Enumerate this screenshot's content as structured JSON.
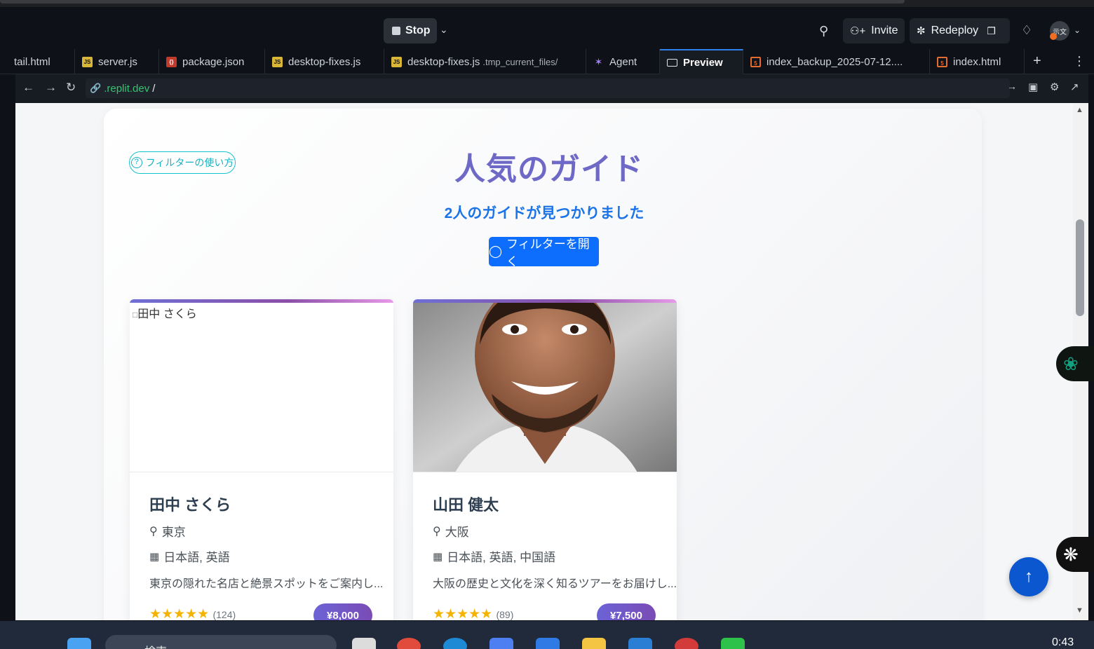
{
  "header": {
    "stop_label": "Stop",
    "invite_label": "Invite",
    "redeploy_label": "Redeploy",
    "avatar_text": "示文"
  },
  "tabs": [
    {
      "label": "tail.html",
      "icon": "html-file-icon"
    },
    {
      "label": "server.js",
      "icon": "js-file-icon"
    },
    {
      "label": "package.json",
      "icon": "json-file-icon"
    },
    {
      "label": "desktop-fixes.js",
      "icon": "js-file-icon"
    },
    {
      "label": "desktop-fixes.js",
      "sub": ".tmp_current_files/",
      "icon": "js-file-icon"
    },
    {
      "label": "Agent",
      "icon": "agent-icon"
    },
    {
      "label": "Preview",
      "icon": "preview-icon",
      "active": true
    },
    {
      "label": "index_backup_2025-07-12....",
      "icon": "html-file-icon"
    },
    {
      "label": "index.html",
      "icon": "html-file-icon"
    }
  ],
  "urlbar": {
    "domain": ".replit.dev",
    "path": "/"
  },
  "page": {
    "help_label": "フィルターの使い方",
    "title": "人気のガイド",
    "subtitle": "2人のガイドが見つかりました",
    "filter_button": "フィルターを開く"
  },
  "guides": [
    {
      "alt": "田中 さくら",
      "name": "田中 さくら",
      "location": "東京",
      "languages": "日本語, 英語",
      "description": "東京の隠れた名店と絶景スポットをご案内し...",
      "stars": "★★★★★",
      "reviews": "(124)",
      "price": "¥8,000",
      "photo_loaded": false
    },
    {
      "alt": "",
      "name": "山田 健太",
      "location": "大阪",
      "languages": "日本語, 英語, 中国語",
      "description": "大阪の歴史と文化を深く知るツアーをお届けし...",
      "stars": "★★★★★",
      "reviews": "(89)",
      "price": "¥7,500",
      "photo_loaded": true
    }
  ],
  "taskbar": {
    "search_placeholder": "検索",
    "clock": "0:43"
  },
  "colors": {
    "accent": "#6e69c7",
    "primary_button": "#0d6efd",
    "help_outline": "#16c3d1",
    "star": "#f5b301"
  }
}
